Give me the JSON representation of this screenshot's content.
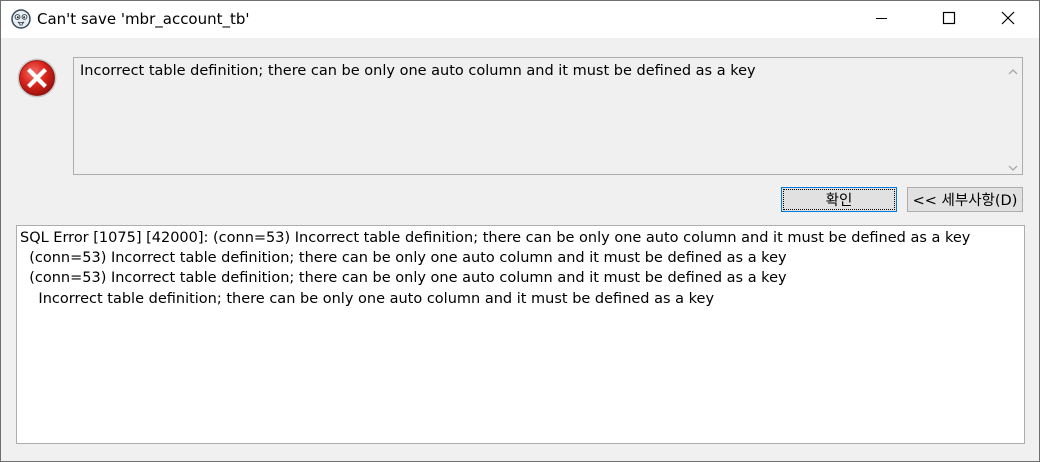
{
  "window": {
    "title": "Can't save 'mbr_account_tb'",
    "app_icon": "dbeaver-beaver-icon",
    "controls": {
      "minimize": "minimize-icon",
      "maximize": "maximize-icon",
      "close": "close-icon"
    }
  },
  "message": {
    "icon": "error-icon",
    "text": "Incorrect table definition; there can be only one auto column and it must be defined as a key"
  },
  "buttons": {
    "ok_label": "확인",
    "details_label": "<< 세부사항(D)"
  },
  "details": {
    "lines": [
      "SQL Error [1075] [42000]: (conn=53) Incorrect table definition; there can be only one auto column and it must be defined as a key",
      "  (conn=53) Incorrect table definition; there can be only one auto column and it must be defined as a key",
      "  (conn=53) Incorrect table definition; there can be only one auto column and it must be defined as a key",
      "    Incorrect table definition; there can be only one auto column and it must be defined as a key"
    ]
  },
  "colors": {
    "error_red": "#d9251d",
    "focus_blue": "#0078d7",
    "button_face": "#e1e1e1",
    "dialog_bg": "#f0f0f0"
  }
}
